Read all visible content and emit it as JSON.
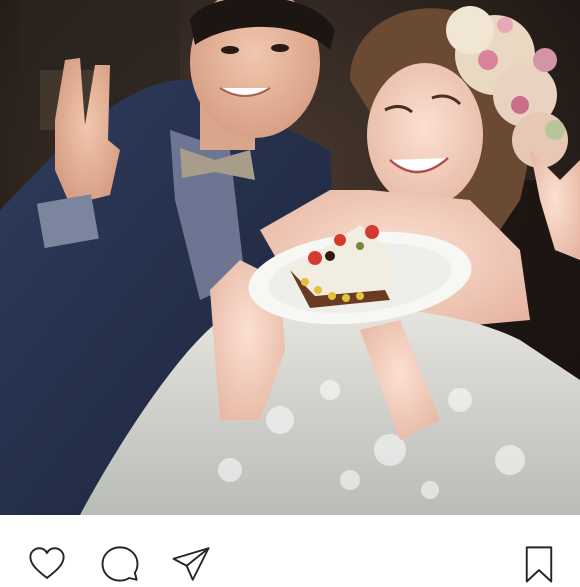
{
  "post": {
    "image_alt": "",
    "icons": {
      "like": "heart-icon",
      "comment": "comment-icon",
      "share": "paper-plane-icon",
      "save": "bookmark-icon"
    },
    "colors": {
      "icon_stroke": "#262626",
      "background": "#ffffff"
    }
  }
}
